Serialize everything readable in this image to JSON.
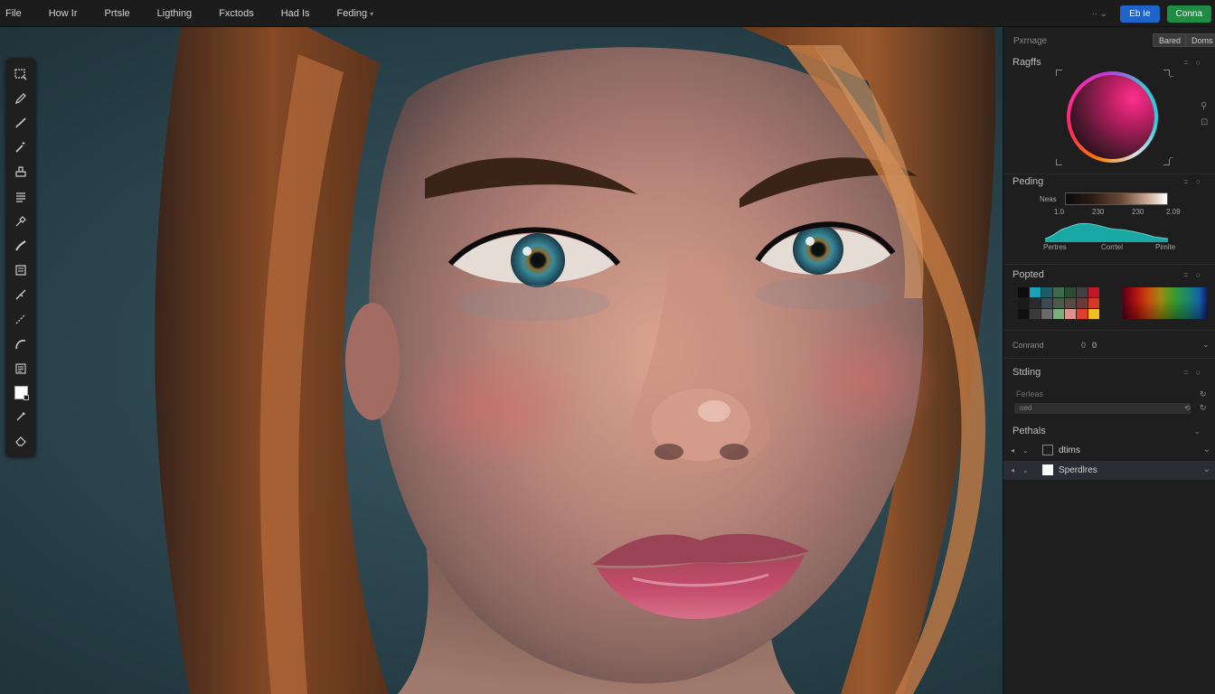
{
  "menubar": {
    "items": [
      "File",
      "How Ir",
      "Prtsle",
      "Ligthing",
      "Fxctods",
      "Had Is",
      "Feding"
    ],
    "mini_label": "··",
    "button_blue": "Eb Ie",
    "button_green": "Conna"
  },
  "panel": {
    "header_title": "Pxrnage",
    "chip1": "Bared",
    "chip2": "Doms",
    "sec_colors": "Ragffs",
    "sec_feathering": "Peding",
    "grad_label": "Neas",
    "ticks": [
      "1.0",
      "230",
      "230",
      "2.09"
    ],
    "histo_labels": [
      "Pertres",
      "Corrtel",
      "Pimite"
    ],
    "sec_presets": "Popted",
    "contrast_label": "Conrand",
    "contrast_value": "0",
    "sec_stacking": "Stding",
    "blend_label": "Ferleas",
    "blend_value": "oed",
    "sec_layers": "Pethals",
    "layers": [
      {
        "name": "dtims"
      },
      {
        "name": "Sperdlres"
      }
    ]
  },
  "palette_colors": [
    "#0c0c0c",
    "#1aa0b8",
    "#1c5c66",
    "#3c6a4a",
    "#2c4a34",
    "#404040",
    "#c01828",
    "#1a1a1a",
    "#2a2a2a",
    "#3a4a50",
    "#4a5a4c",
    "#5a4a44",
    "#6a3a34",
    "#d23a2a",
    "#101010",
    "#3a3a3a",
    "#6a6a6a",
    "#7ab07a",
    "#e09090",
    "#e0402a",
    "#f0c020"
  ],
  "colors": {
    "accent_blue": "#1e63c9",
    "accent_green": "#1f8b43"
  }
}
